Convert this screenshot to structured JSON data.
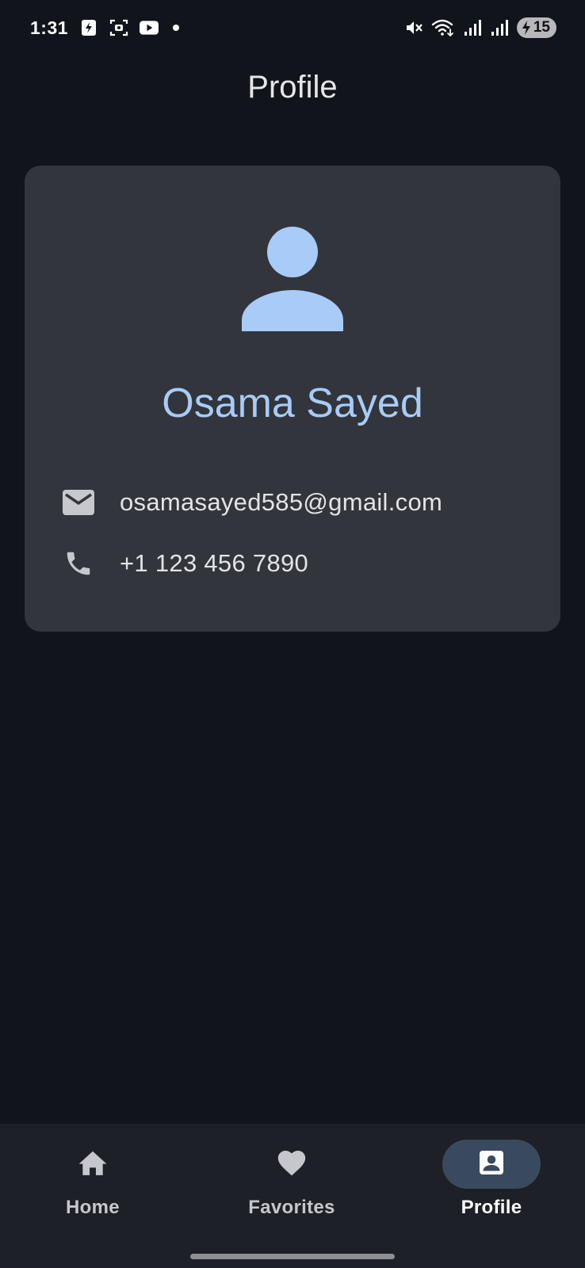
{
  "status_bar": {
    "time": "1:31",
    "left_icons": [
      "fitness-app-icon",
      "screenshot-icon",
      "youtube-icon",
      "notification-dot"
    ],
    "right_icons": [
      "mute-icon",
      "wifi-icon",
      "signal-icon",
      "signal-icon"
    ],
    "battery_level": "15",
    "battery_charging": true
  },
  "header": {
    "title": "Profile"
  },
  "profile": {
    "avatar_icon": "person-icon",
    "name": "Osama Sayed",
    "email_icon": "email-icon",
    "email": "osamasayed585@gmail.com",
    "phone_icon": "phone-icon",
    "phone": "+1 123 456 7890"
  },
  "bottom_nav": {
    "items": [
      {
        "label": "Home",
        "icon": "home-icon",
        "active": false
      },
      {
        "label": "Favorites",
        "icon": "heart-icon",
        "active": false
      },
      {
        "label": "Profile",
        "icon": "contact-card-icon",
        "active": true
      }
    ]
  },
  "colors": {
    "background": "#11141a",
    "card": "#32353b",
    "accent": "#a8cbf7",
    "nav_background": "#1d2026",
    "active_pill": "#3a4a5e"
  }
}
